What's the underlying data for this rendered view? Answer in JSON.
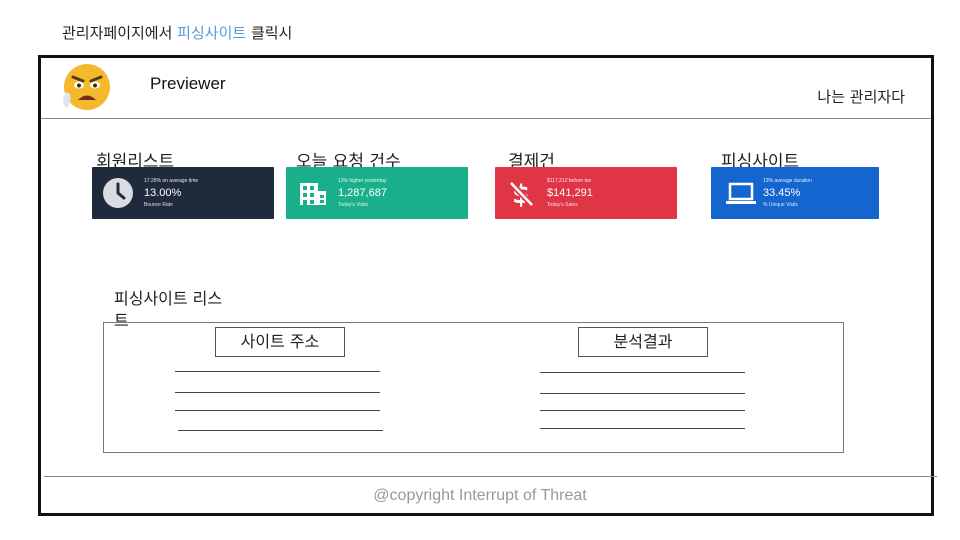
{
  "caption": {
    "prefix": "관리자페이지에서 ",
    "highlight": "피싱사이트",
    "suffix": " 클릭시"
  },
  "header": {
    "avatar_icon": "angry-emoji-icon",
    "title": "Previewer",
    "user_label": "나는 관리자다"
  },
  "stats": [
    {
      "label": "회원리스트",
      "icon": "clock-icon",
      "color": "#1f2b3d",
      "sub": "17.25% on average time",
      "value": "13.00%",
      "foot": "Bounce Rate"
    },
    {
      "label": "오늘 요청 건수",
      "icon": "building-icon",
      "color": "#1aaf8b",
      "sub": "13% higher yesterday",
      "value": "1,287,687",
      "foot": "Today's Visits"
    },
    {
      "label": "결제건",
      "icon": "dollar-slash-icon",
      "color": "#e03545",
      "sub": "$117,212 before tax",
      "value": "$141,291",
      "foot": "Today's Sales"
    },
    {
      "label": "피싱사이트",
      "icon": "laptop-icon",
      "color": "#1565d0",
      "sub": "13% average duration",
      "value": "33.45%",
      "foot": "% Unique Visits"
    }
  ],
  "phishing_list": {
    "title": "피싱사이트 리스트",
    "columns": [
      "사이트 주소",
      "분석결과"
    ]
  },
  "footer": {
    "copyright": "@copyright Interrupt of Threat"
  }
}
